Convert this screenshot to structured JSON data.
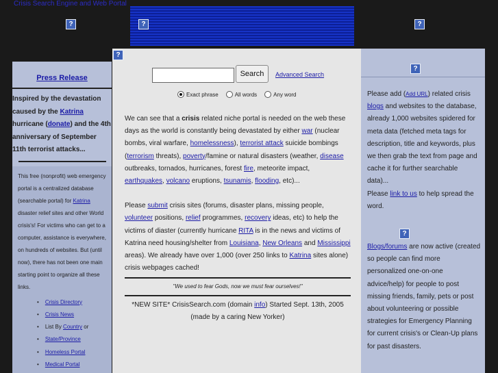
{
  "site_title": "Crisis Search Engine and Web Portal",
  "help_icon": "?",
  "left": {
    "press_release": "Press Release",
    "inspired": {
      "t1": "Inspired by the devastation caused by the ",
      "katrina": "Katrina",
      "t2": " hurricane (",
      "donate": "donate",
      "t3": ") and the 4th anniversary of September 11th terrorist attacks..."
    },
    "about": {
      "t1": "This free (nonprofit) web emergency portal is a centralized database (searchable portal) for ",
      "katrina": "Katrina",
      "t2": " disaster relief sites and other World crisis's! For victims who can get to a computer, assistance is everywhere, on hundreds of websites. But (until now), there has not been one main starting point to organize all these links."
    },
    "links": {
      "directory": "Crisis Directory",
      "news": "Crisis News",
      "list_by": "List By ",
      "country": "Country",
      "or": " or",
      "state": "State/Province",
      "homeless": "Homeless Portal",
      "medical": "Medical Portal"
    }
  },
  "search": {
    "input_value": "",
    "button": "Search",
    "advanced": "Advanced Search",
    "options": [
      "Exact phrase",
      "All words",
      "Any word"
    ],
    "selected": "Exact phrase"
  },
  "center": {
    "p1": {
      "t1": "We can see that a ",
      "crisis": "crisis",
      "t2": " related niche portal is needed on the web these days as the world is constantly being devastated by either ",
      "war": "war",
      "t3": " (nuclear bombs, viral warfare, ",
      "homelessness": "homelessness",
      "t4": "), ",
      "terrorist_attack": "terrorist attack",
      "t5": " suicide bombings (",
      "terrorism": "terrorism",
      "t6": " threats), ",
      "poverty": "poverty",
      "t7": "/famine or natural disasters (weather, ",
      "disease": "disease",
      "t8": " outbreaks, tornados, hurricanes, forest ",
      "fire": "fire",
      "t9": ", meteorite impact, ",
      "earthquakes": "earthquakes",
      "t10": ", ",
      "volcano": "volcano",
      "t11": " eruptions, ",
      "tsunamis": "tsunamis",
      "t12": ", ",
      "flooding": "flooding",
      "t13": ", etc)..."
    },
    "p2": {
      "t1": "Please ",
      "submit": "submit",
      "t2": " crisis sites (forums, disaster plans, missing people, ",
      "volunteer": "volunteer",
      "t3": " positions, ",
      "relief": "relief",
      "t4": " programmes, ",
      "recovery": "recovery",
      "t5": " ideas, etc) to help the victims of diaster (currently hurricane ",
      "rita": "RITA",
      "t6": " is in the news and victims of Katrina need housing/shelter from ",
      "louisiana": "Louisiana",
      "t7": ", ",
      "new_orleans": "New Orleans",
      "t8": " and ",
      "mississippi": "Mississippi",
      "t9": " areas). We already have over 1,000 (over 250 links to ",
      "katrina": "Katrina",
      "t10": " sites alone) crisis webpages cached!"
    },
    "quote": "\"We used to fear Gods, now we must fear ourselves!\"",
    "newsite": {
      "t1": "*NEW SITE* CrisisSearch.com (domain ",
      "info": "info",
      "t2": ") Started Sept. 13th, 2005",
      "t3": "(made by a caring New Yorker)"
    }
  },
  "right": {
    "block1": {
      "t1": "Please add (",
      "add_url": "Add URL",
      "t2": ") related crisis ",
      "blogs": "blogs",
      "t3": " and websites to the database, already 1,000 websites spidered for meta data (fetched meta tags for description, title and keywords, plus we then grab the text from page and cache it for further searchable data)...",
      "t4": "Please ",
      "link_to_us": "link to us",
      "t5": " to help spread the word."
    },
    "block2": {
      "blogs_forums": "Blogs/forums",
      "t1": " are now active (created so people can find more personalized one-on-one advice/help) for people to post missing friends, family, pets or post about volunteering or possible strategies for Emergency Planning for current crisis's or Clean-Up plans for past disasters."
    }
  }
}
